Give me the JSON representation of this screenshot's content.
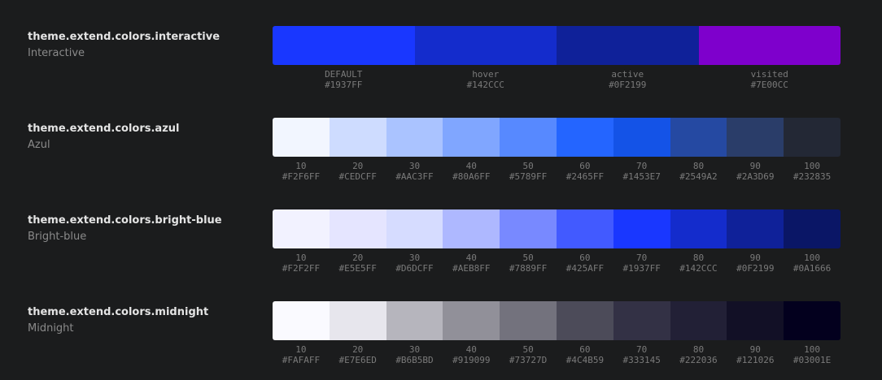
{
  "rows": [
    {
      "title": "theme.extend.colors.interactive",
      "name": "Interactive",
      "swatches": [
        {
          "label": "DEFAULT",
          "hex": "#1937FF"
        },
        {
          "label": "hover",
          "hex": "#142CCC"
        },
        {
          "label": "active",
          "hex": "#0F2199"
        },
        {
          "label": "visited",
          "hex": "#7E00CC"
        }
      ]
    },
    {
      "title": "theme.extend.colors.azul",
      "name": "Azul",
      "swatches": [
        {
          "label": "10",
          "hex": "#F2F6FF"
        },
        {
          "label": "20",
          "hex": "#CEDCFF"
        },
        {
          "label": "30",
          "hex": "#AAC3FF"
        },
        {
          "label": "40",
          "hex": "#80A6FF"
        },
        {
          "label": "50",
          "hex": "#5789FF"
        },
        {
          "label": "60",
          "hex": "#2465FF"
        },
        {
          "label": "70",
          "hex": "#1453E7"
        },
        {
          "label": "80",
          "hex": "#2549A2"
        },
        {
          "label": "90",
          "hex": "#2A3D69"
        },
        {
          "label": "100",
          "hex": "#232835"
        }
      ]
    },
    {
      "title": "theme.extend.colors.bright-blue",
      "name": "Bright-blue",
      "swatches": [
        {
          "label": "10",
          "hex": "#F2F2FF"
        },
        {
          "label": "20",
          "hex": "#E5E5FF"
        },
        {
          "label": "30",
          "hex": "#D6DCFF"
        },
        {
          "label": "40",
          "hex": "#AEB8FF"
        },
        {
          "label": "50",
          "hex": "#7889FF"
        },
        {
          "label": "60",
          "hex": "#425AFF"
        },
        {
          "label": "70",
          "hex": "#1937FF"
        },
        {
          "label": "80",
          "hex": "#142CCC"
        },
        {
          "label": "90",
          "hex": "#0F2199"
        },
        {
          "label": "100",
          "hex": "#0A1666"
        }
      ]
    },
    {
      "title": "theme.extend.colors.midnight",
      "name": "Midnight",
      "swatches": [
        {
          "label": "10",
          "hex": "#FAFAFF"
        },
        {
          "label": "20",
          "hex": "#E7E6ED"
        },
        {
          "label": "30",
          "hex": "#B6B5BD"
        },
        {
          "label": "40",
          "hex": "#919099"
        },
        {
          "label": "50",
          "hex": "#73727D"
        },
        {
          "label": "60",
          "hex": "#4C4B59"
        },
        {
          "label": "70",
          "hex": "#333145"
        },
        {
          "label": "80",
          "hex": "#222036"
        },
        {
          "label": "90",
          "hex": "#121026"
        },
        {
          "label": "100",
          "hex": "#03001E"
        }
      ]
    }
  ]
}
